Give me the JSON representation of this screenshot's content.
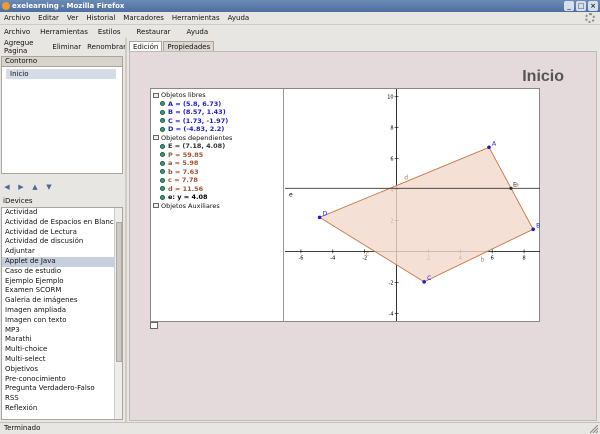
{
  "window": {
    "title": "exelearning - Mozilla Firefox"
  },
  "browser_menu": [
    "Archivo",
    "Editar",
    "Ver",
    "Historial",
    "Marcadores",
    "Herramientas",
    "Ayuda"
  ],
  "app_menu": [
    "Archivo",
    "Herramientas",
    "Estilos",
    "Restaurar",
    "Ayuda"
  ],
  "toolbar": {
    "add_page": "Agregue Pagina",
    "delete": "Eliminar",
    "rename": "Renombrar"
  },
  "outline": {
    "header": "Contorno",
    "items": [
      "Inicio"
    ]
  },
  "idevices": {
    "label": "iDevices",
    "items": [
      "Actividad",
      "Actividad de Espacios en Blanco",
      "Actividad de Lectura",
      "Actividad de discusión",
      "Adjuntar",
      "Applet de Java",
      "Caso de estudio",
      "Ejemplo Ejemplo",
      "Examen SCORM",
      "Galeria de imágenes",
      "Imagen ampliada",
      "Imagen con texto",
      "MP3",
      "Marathi",
      "Multi-choice",
      "Multi-select",
      "Objetivos",
      "Pre-conocimiento",
      "Pregunta Verdadero-Falso",
      "RSS",
      "Reflexión"
    ],
    "selected": 5
  },
  "tabs": [
    "Edición",
    "Propiedades"
  ],
  "page": {
    "title": "Inicio"
  },
  "algebra": {
    "free_header": "Objetos libres",
    "free": [
      {
        "text": "A = (5.8, 6.73)",
        "color": "#1a1ad6"
      },
      {
        "text": "B = (8.57, 1.43)",
        "color": "#1a1ad6"
      },
      {
        "text": "C = (1.73, -1.97)",
        "color": "#1a1ad6"
      },
      {
        "text": "D = (-4.83, 2.2)",
        "color": "#1a1ad6"
      }
    ],
    "dep_header": "Objetos dependientes",
    "dep": [
      {
        "text": "E = (7.18, 4.08)",
        "color": "#333333"
      },
      {
        "text": "P = 59.85",
        "color": "#a0522d"
      },
      {
        "text": "a = 5.98",
        "color": "#a0522d"
      },
      {
        "text": "b = 7.63",
        "color": "#a0522d"
      },
      {
        "text": "c = 7.78",
        "color": "#a0522d"
      },
      {
        "text": "d = 11.56",
        "color": "#a0522d"
      },
      {
        "text": "e: y = 4.08",
        "color": "#000000"
      }
    ],
    "aux_header": "Objetos Auxiliares"
  },
  "graph": {
    "xlim": [
      -7,
      9
    ],
    "ylim": [
      -4.5,
      10.5
    ],
    "x_ticks": [
      -6,
      -4,
      -2,
      2,
      4,
      6,
      8
    ],
    "y_ticks": [
      -4,
      -2,
      2,
      4,
      6,
      8,
      10
    ],
    "points": [
      {
        "name": "A",
        "x": 5.8,
        "y": 6.73
      },
      {
        "name": "B",
        "x": 8.57,
        "y": 1.43
      },
      {
        "name": "C",
        "x": 1.73,
        "y": -1.97
      },
      {
        "name": "D",
        "x": -4.83,
        "y": 2.2
      }
    ],
    "E": {
      "name": "E",
      "x": 7.18,
      "y": 4.08
    },
    "line_e": {
      "label": "e",
      "y": 4.08
    },
    "segment_labels": {
      "a": "a",
      "b": "b",
      "c": "c",
      "d": "d"
    },
    "polygon_fill": "#f3d8cc",
    "polygon_stroke": "#c9743f",
    "point_color": "#1a1ad6"
  },
  "status": {
    "text": "Terminado"
  }
}
